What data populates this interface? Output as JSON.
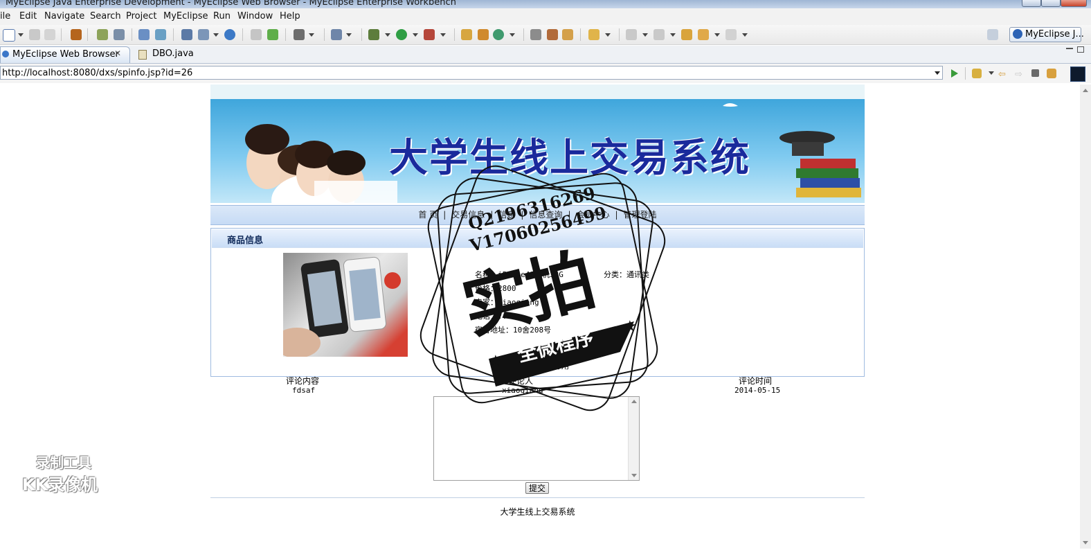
{
  "window": {
    "title": "MyEclipse Java Enterprise Development - MyEclipse Web Browser - MyEclipse Enterprise Workbench"
  },
  "menu": [
    "ile",
    "Edit",
    "Navigate",
    "Search",
    "Project",
    "MyEclipse",
    "Run",
    "Window",
    "Help"
  ],
  "toolbar": {
    "perspective_label": "MyEclipse J..."
  },
  "tabs": [
    {
      "label": "MyEclipse Web Browser",
      "active": true
    },
    {
      "label": "DBO.java",
      "active": false
    }
  ],
  "address": {
    "url": "http://localhost:8080/dxs/spinfo.jsp?id=26"
  },
  "site": {
    "banner_title": "大学生线上交易系统",
    "nav": [
      "首 页",
      "交易信息",
      "信息",
      "信息查询",
      "会员中心",
      "管理登陆"
    ],
    "footer": "大学生线上交易系统"
  },
  "product": {
    "section_title": "商品信息",
    "lines": {
      "name": "名称：iPhone4S手机32G",
      "category": "分类：通讯类",
      "price": "价格：2800",
      "seller": "卖家：xiaoqiang",
      "phone": "电话：...",
      "address": "宿舍地址：10舍208号",
      "desc": "描述：完美好用"
    }
  },
  "comments": {
    "headers": {
      "content": "评论内容",
      "author": "评论人",
      "time": "评论时间"
    },
    "rows": [
      {
        "content": "fdsaf",
        "author": "xiaoqiang",
        "time": "2014-05-15"
      }
    ],
    "submit_label": "提交"
  },
  "watermark": {
    "contact1": "Q2196316269",
    "contact2": "V17060256499",
    "main": "实拍",
    "ribbon": "全微程序"
  },
  "recorder": {
    "line1": "录制工具",
    "line2": "KK录像机"
  }
}
